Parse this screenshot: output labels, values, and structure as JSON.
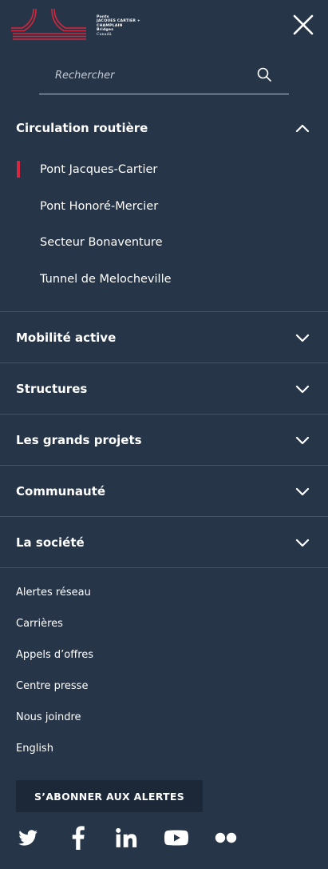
{
  "logo": {
    "line1": "Ponts",
    "line2": "JACQUES CARTIER +",
    "line3": "CHAMPLAIN",
    "line4": "Bridges",
    "line5": "Canadä",
    "accent_color": "#d7263d"
  },
  "header": {
    "close_icon": "close-icon"
  },
  "search": {
    "placeholder": "Rechercher",
    "value": "",
    "icon": "search-icon"
  },
  "menu": {
    "sections": [
      {
        "label": "Circulation routière",
        "expanded": true
      },
      {
        "label": "Mobilité active",
        "expanded": false
      },
      {
        "label": "Structures",
        "expanded": false
      },
      {
        "label": "Les grands projets",
        "expanded": false
      },
      {
        "label": "Communauté",
        "expanded": false
      },
      {
        "label": "La société",
        "expanded": false
      }
    ],
    "circulation_items": [
      {
        "label": "Pont Jacques-Cartier",
        "active": true
      },
      {
        "label": "Pont Honoré-Mercier",
        "active": false
      },
      {
        "label": "Secteur Bonaventure",
        "active": false
      },
      {
        "label": "Tunnel de Melocheville",
        "active": false
      }
    ]
  },
  "footer": {
    "links": [
      "Alertes réseau",
      "Carrières",
      "Appels d’offres",
      "Centre presse",
      "Nous joindre",
      "English"
    ],
    "subscribe_label": "S’ABONNER AUX ALERTES",
    "social": [
      "twitter-icon",
      "facebook-icon",
      "linkedin-icon",
      "youtube-icon",
      "flickr-icon"
    ]
  },
  "colors": {
    "background": "#263548",
    "divider": "#46556a",
    "active_marker": "#d7263d",
    "button_bg": "#1c2838"
  }
}
